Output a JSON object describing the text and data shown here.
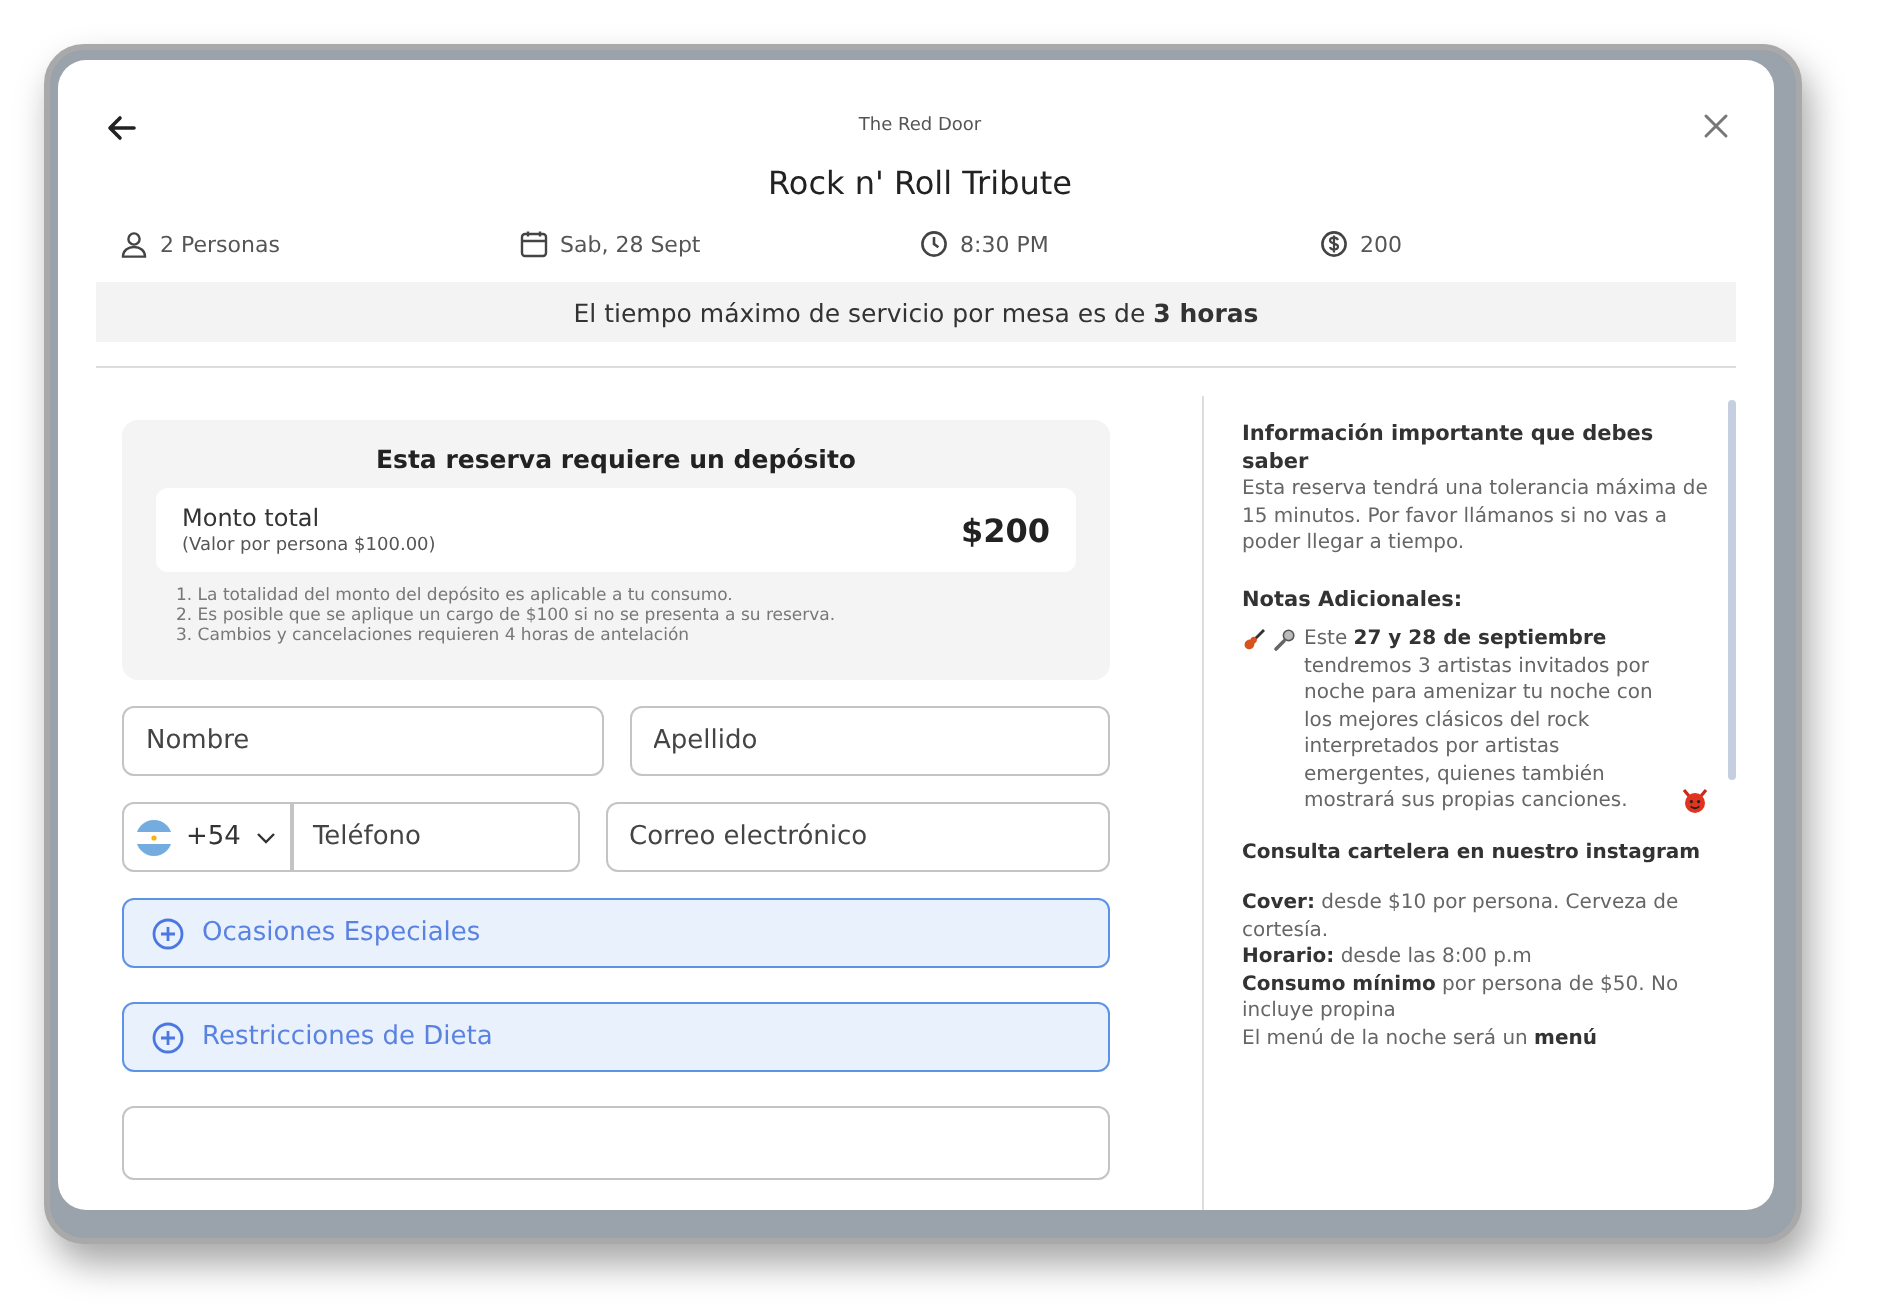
{
  "header": {
    "venue": "The Red Door",
    "title": "Rock n' Roll Tribute"
  },
  "details": [
    {
      "kind": "guests",
      "text": "2 Personas"
    },
    {
      "kind": "date",
      "text": "Sab, 28 Sept"
    },
    {
      "kind": "time",
      "text": "8:30 PM"
    },
    {
      "kind": "price",
      "text": "200"
    }
  ],
  "notice": "El tiempo máximo de servicio por mesa es de **3 horas**",
  "deposit": {
    "title": "Esta reserva requiere un depósito",
    "total_label": "Monto total",
    "per_person": "(Valor por persona $100.00)",
    "amount": "$200",
    "terms": [
      "1. La totalidad del monto del depósito es aplicable a tu consumo.",
      "2. Es posible que se aplique un cargo de $100 si no se presenta a su reserva.",
      "3. Cambios y cancelaciones requieren 4 horas de antelación"
    ]
  },
  "form": {
    "first_name": {
      "placeholder": "Nombre"
    },
    "last_name": {
      "placeholder": "Apellido"
    },
    "phone": {
      "country_code": "+54",
      "placeholder": "Teléfono"
    },
    "email": {
      "placeholder": "Correo electrónico"
    },
    "expanders": [
      {
        "label": "Ocasiones Especiales"
      },
      {
        "label": "Restricciones de Dieta"
      }
    ]
  },
  "info": {
    "title": "Información importante que debes saber",
    "text": "Esta reserva tendrá una tolerancia máxima de 15 minutos. Por favor llámanos si no vas a poder llegar a tiempo.",
    "notes_title": "Notas Adicionales:",
    "notes": [
      {
        "kind": "event",
        "text": "Este **27 y 28 de septiembre** tendremos 3 artistas invitados por noche para amenizar tu noche con los mejores clásicos del rock interpretados por artistas emergentes, quienes también mostrará sus propias canciones."
      },
      {
        "kind": "heading",
        "text": "Consulta cartelera en nuestro instagram"
      },
      {
        "kind": "lines",
        "lines": [
          "**Cover:** desde $10 por persona. Cerveza de cortesía.",
          "**Horario:** desde las 8:00 p.m",
          "**Consumo mínimo** por persona de $50. No incluye propina",
          "El menú de la noche será un **menú**"
        ]
      }
    ]
  }
}
